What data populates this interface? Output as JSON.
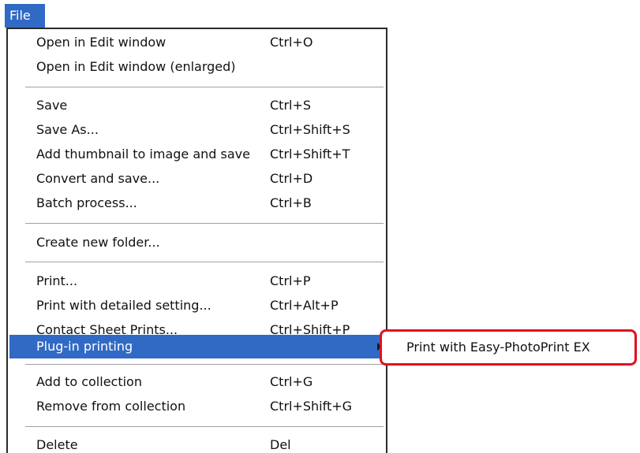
{
  "menubar": {
    "file_label": "File"
  },
  "file_menu": {
    "items": [
      {
        "label": "Open in Edit window",
        "shortcut": "Ctrl+O"
      },
      {
        "label": "Open in Edit window (enlarged)",
        "shortcut": ""
      },
      {
        "label": "Save",
        "shortcut": "Ctrl+S"
      },
      {
        "label": "Save As...",
        "shortcut": "Ctrl+Shift+S"
      },
      {
        "label": "Add thumbnail to image and save",
        "shortcut": "Ctrl+Shift+T"
      },
      {
        "label": "Convert and save...",
        "shortcut": "Ctrl+D"
      },
      {
        "label": "Batch process...",
        "shortcut": "Ctrl+B"
      },
      {
        "label": "Create new folder...",
        "shortcut": ""
      },
      {
        "label": "Print...",
        "shortcut": "Ctrl+P"
      },
      {
        "label": "Print with detailed setting...",
        "shortcut": "Ctrl+Alt+P"
      },
      {
        "label": "Contact Sheet Prints...",
        "shortcut": "Ctrl+Shift+P"
      },
      {
        "label": "Plug-in printing",
        "shortcut": "",
        "highlighted": true,
        "has_submenu": true
      },
      {
        "label": "Add to collection",
        "shortcut": "Ctrl+G"
      },
      {
        "label": "Remove from collection",
        "shortcut": "Ctrl+Shift+G"
      },
      {
        "label": "Delete",
        "shortcut": "Del"
      }
    ]
  },
  "submenu": {
    "items": [
      {
        "label": "Print with Easy-PhotoPrint EX"
      }
    ],
    "highlight_color": "#e01020"
  },
  "colors": {
    "selection": "#316ac5",
    "menu_text": "#111111"
  }
}
